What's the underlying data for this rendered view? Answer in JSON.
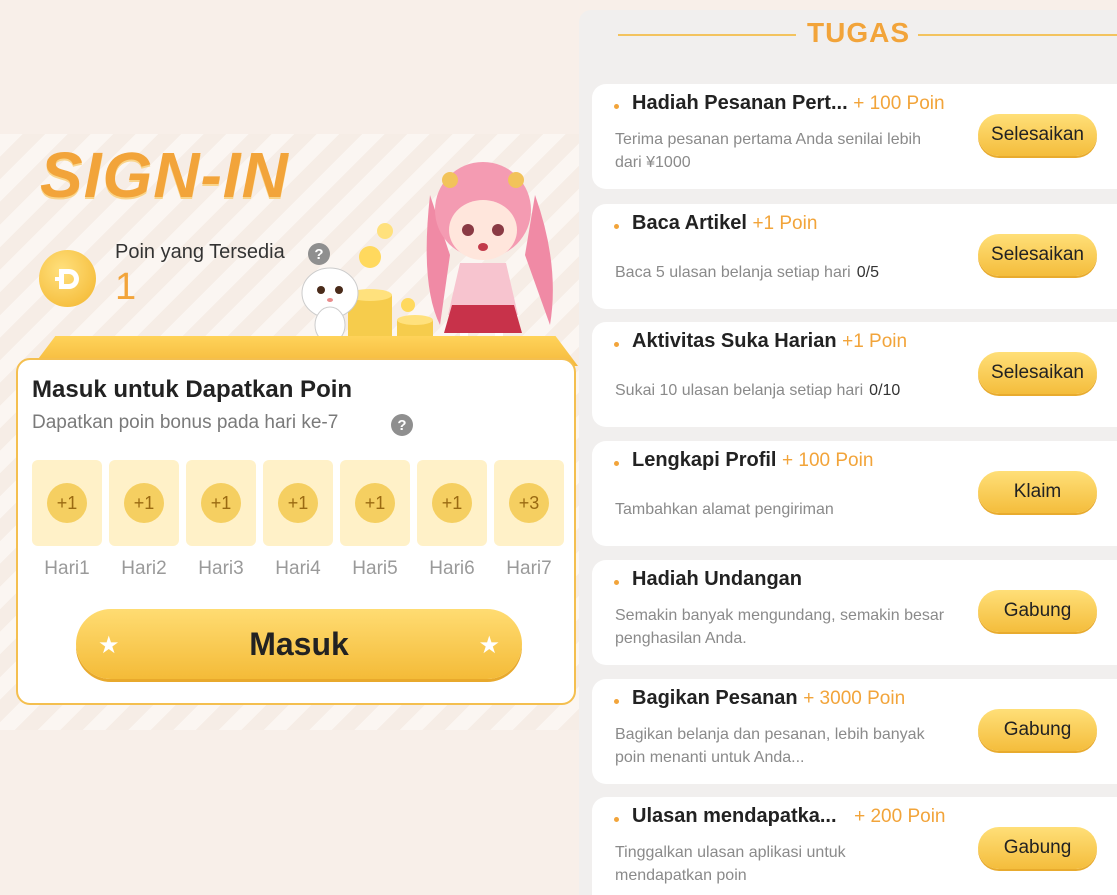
{
  "signin": {
    "title": "SIGN-IN",
    "points_label": "Poin yang Tersedia",
    "points_value": "1",
    "help_glyph": "?",
    "icons": {
      "coin": "coin-d-icon",
      "help": "question-icon",
      "star": "star-icon"
    }
  },
  "checkin_card": {
    "title": "Masuk untuk Dapatkan Poin",
    "subtitle": "Dapatkan poin bonus pada hari ke-7",
    "days": [
      {
        "reward": "+1",
        "label": "Hari1"
      },
      {
        "reward": "+1",
        "label": "Hari2"
      },
      {
        "reward": "+1",
        "label": "Hari3"
      },
      {
        "reward": "+1",
        "label": "Hari4"
      },
      {
        "reward": "+1",
        "label": "Hari5"
      },
      {
        "reward": "+1",
        "label": "Hari6"
      },
      {
        "reward": "+3",
        "label": "Hari7"
      }
    ],
    "button_label": "Masuk"
  },
  "tasks": {
    "header": "TUGAS",
    "items": [
      {
        "title": "Hadiah Pesanan Pert...",
        "points": "+ 100 Poin",
        "desc": "Terima pesanan pertama Anda senilai lebih dari ¥1000",
        "progress": "",
        "button": "Selesaikan"
      },
      {
        "title": "Baca Artikel",
        "points": "+1 Poin",
        "desc": "Baca 5 ulasan belanja setiap hari",
        "progress": "0/5",
        "button": "Selesaikan"
      },
      {
        "title": "Aktivitas Suka Harian",
        "points": "+1 Poin",
        "desc": "Sukai 10 ulasan belanja setiap hari",
        "progress": "0/10",
        "button": "Selesaikan"
      },
      {
        "title": "Lengkapi Profil",
        "points": "+ 100 Poin",
        "desc": "Tambahkan alamat pengiriman",
        "progress": "",
        "button": "Klaim"
      },
      {
        "title": "Hadiah Undangan",
        "points": "",
        "desc": "Semakin banyak mengundang, semakin besar penghasilan Anda.",
        "progress": "",
        "button": "Gabung"
      },
      {
        "title": "Bagikan Pesanan",
        "points": "+ 3000 Poin",
        "desc": "Bagikan belanja dan pesanan, lebih banyak poin menanti untuk Anda...",
        "progress": "",
        "button": "Gabung"
      },
      {
        "title": "Ulasan mendapatka...",
        "points": "+ 200 Poin",
        "desc": "Tinggalkan ulasan aplikasi untuk mendapatkan poin",
        "progress": "",
        "button": "Gabung"
      }
    ]
  },
  "colors": {
    "accent": "#f2a43a",
    "button": "#f7c64a",
    "day_bg": "#fff1c8"
  }
}
